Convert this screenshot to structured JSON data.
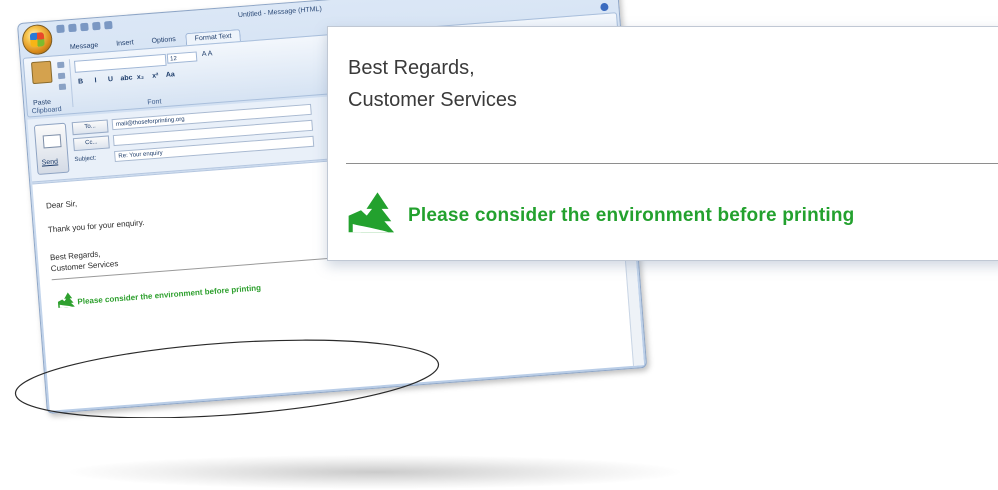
{
  "window": {
    "title": "Untitled - Message (HTML)",
    "controls": [
      "_",
      "▫",
      "x"
    ],
    "tabs": [
      {
        "label": "Message",
        "active": false
      },
      {
        "label": "Insert",
        "active": false
      },
      {
        "label": "Options",
        "active": false
      },
      {
        "label": "Format Text",
        "active": true
      }
    ]
  },
  "ribbon": {
    "paste_label": "Paste",
    "clipboard_label": "Clipboard",
    "font_label": "Font",
    "font_size": "12",
    "grow_shrink": "A A",
    "format_buttons": [
      "B",
      "I",
      "U",
      "abc",
      "x₂",
      "x²",
      "Aa"
    ]
  },
  "header": {
    "send_label": "Send",
    "to_label": "To...",
    "to_value": "mail@thoseforprinting.org",
    "cc_label": "Cc...",
    "cc_value": "",
    "subject_label": "Subject:",
    "subject_value": "Re: Your enquiry"
  },
  "body": {
    "greeting": "Dear Sir,",
    "line1": "Thank you for your enquiry.",
    "regards": "Best Regards,",
    "services": "Customer Services",
    "notice": "Please consider the environment before printing"
  },
  "zoom": {
    "regards": "Best Regards,",
    "services": "Customer Services",
    "notice": "Please consider the environment before printing"
  },
  "colors": {
    "notice_green": "#23a12e",
    "window_blue": "#b9cde7"
  }
}
